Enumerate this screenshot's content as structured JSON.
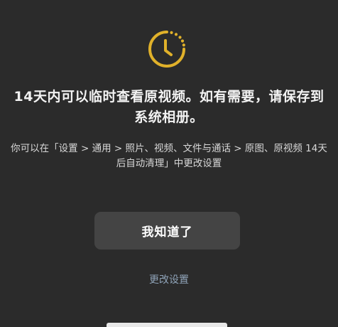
{
  "dialog": {
    "icon": "clock-icon",
    "accent_color": "#e0b12a",
    "title": "14天内可以临时查看原视频。如有需要，请保存到系统相册。",
    "description": "你可以在「设置 > 通用 > 照片、视频、文件与通话 > 原图、原视频 14天后自动清理」中更改设置",
    "primary_button": "我知道了",
    "secondary_link": "更改设置"
  }
}
